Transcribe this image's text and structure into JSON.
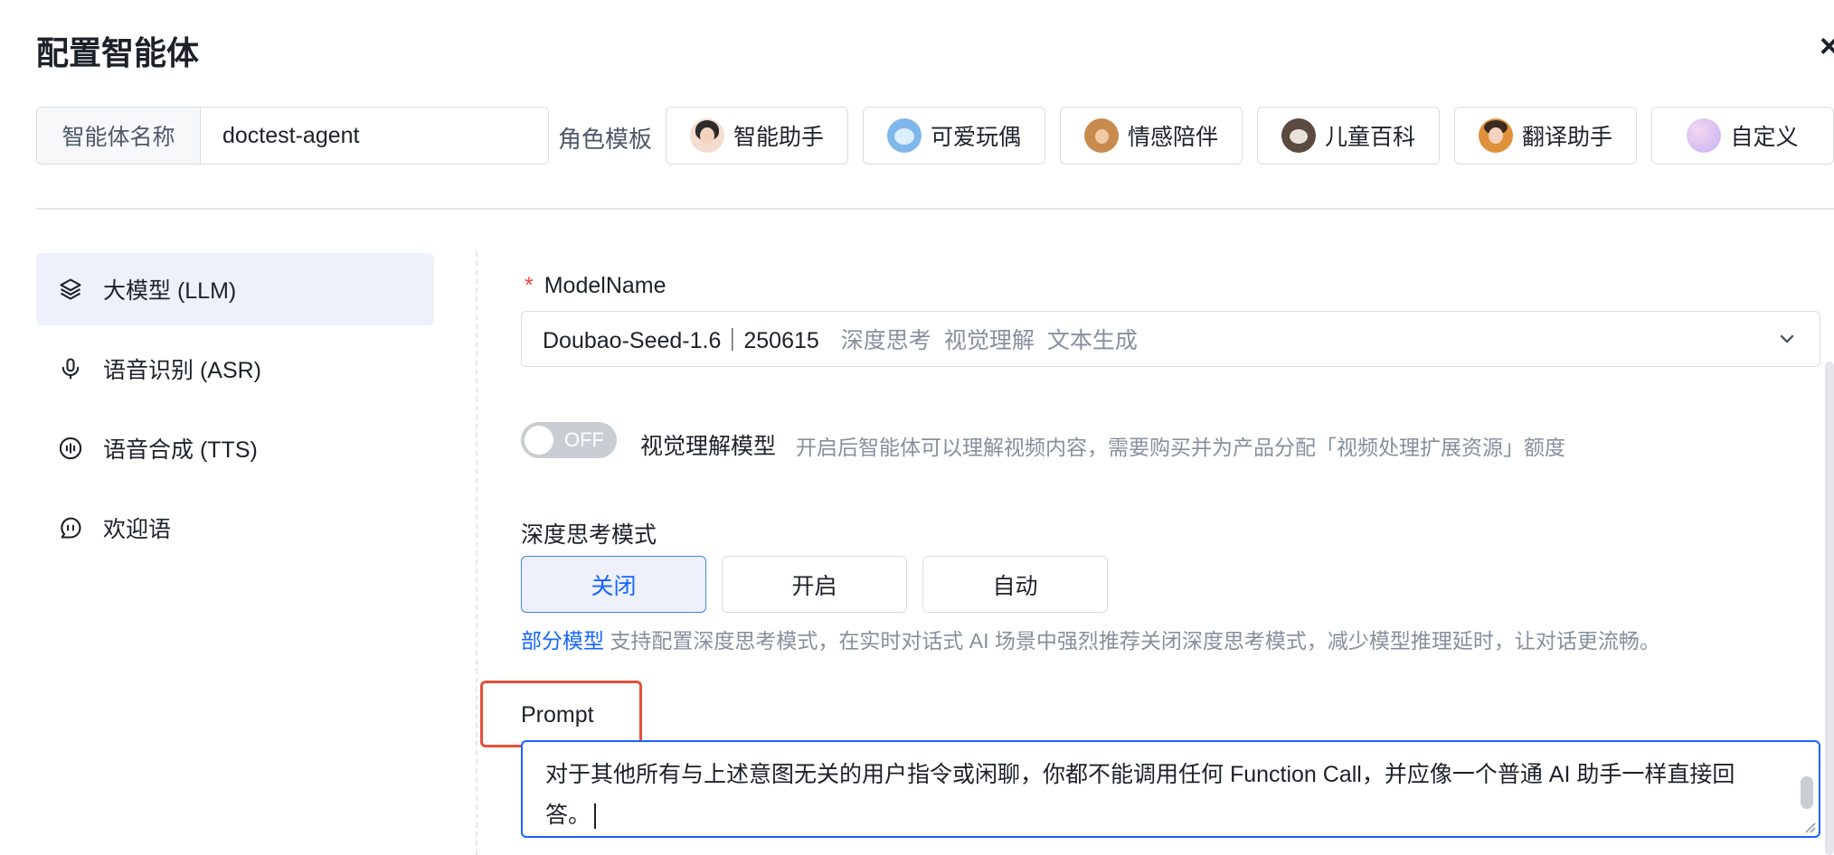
{
  "dialog": {
    "title": "配置智能体",
    "close": "×"
  },
  "name_field": {
    "label": "智能体名称",
    "value": "doctest-agent"
  },
  "templates": {
    "label": "角色模板",
    "items": [
      {
        "label": "智能助手",
        "avatar_color": "#f4ddd0"
      },
      {
        "label": "可爱玩偶",
        "avatar_color": "#7fb7ea"
      },
      {
        "label": "情感陪伴",
        "avatar_color": "#c98a4f"
      },
      {
        "label": "儿童百科",
        "avatar_color": "#5a4a3f"
      },
      {
        "label": "翻译助手",
        "avatar_color": "#e0913c"
      },
      {
        "label": "自定义",
        "avatar_color": "#d9c2f0"
      }
    ]
  },
  "sidebar": {
    "items": [
      {
        "label": "大模型 (LLM)",
        "icon": "layers-icon",
        "active": true
      },
      {
        "label": "语音识别 (ASR)",
        "icon": "microphone-icon",
        "active": false
      },
      {
        "label": "语音合成 (TTS)",
        "icon": "waveform-icon",
        "active": false
      },
      {
        "label": "欢迎语",
        "icon": "chat-bubble-icon",
        "active": false
      }
    ]
  },
  "model": {
    "required_mark": "*",
    "label": "ModelName",
    "selected": "Doubao-Seed-1.6｜250615",
    "tags": [
      "深度思考",
      "视觉理解",
      "文本生成"
    ]
  },
  "vision": {
    "toggle_state": "OFF",
    "title": "视觉理解模型",
    "description": "开启后智能体可以理解视频内容，需要购买并为产品分配「视频处理扩展资源」额度"
  },
  "deep_think": {
    "label": "深度思考模式",
    "options": [
      "关闭",
      "开启",
      "自动"
    ],
    "selected": "关闭",
    "hint_link": "部分模型",
    "hint_text": " 支持配置深度思考模式，在实时对话式 AI 场景中强烈推荐关闭深度思考模式，减少模型推理延时，让对话更流畅。"
  },
  "prompt": {
    "label": "Prompt",
    "value": "对于其他所有与上述意图无关的用户指令或闲聊，你都不能调用任何 Function Call，并应像一个普通 AI 助手一样直接回答。"
  },
  "colors": {
    "accent": "#1664ff",
    "active_bg": "#eef1fc",
    "highlight_box": "#e8503a"
  }
}
